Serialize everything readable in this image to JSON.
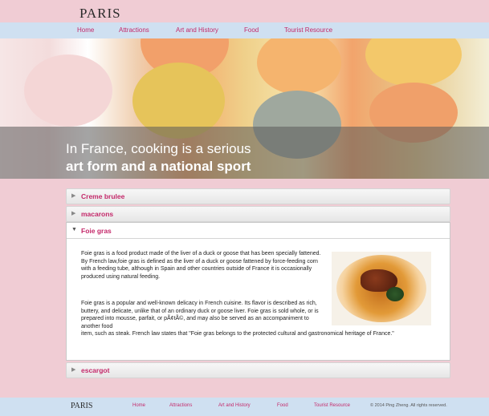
{
  "site": {
    "logo": "PARIS"
  },
  "nav": [
    "Home",
    "Attractions",
    "Art and History",
    "Food",
    "Tourist Resource"
  ],
  "hero": {
    "line1": "In France, cooking is a serious",
    "line2": "art form and a national sport"
  },
  "accordion": {
    "collapsed_top": [
      "Creme brulee",
      "macarons"
    ],
    "expanded": {
      "title": "Foie gras",
      "paragraph1": "Foie gras is a food product made of the liver of a duck or goose that has been specially fattened. By French law,foie gras is defined as the liver of a duck or goose fattened by force-feeding corn with a feeding tube, although in Spain and other countries outside of France it is occasionally produced using natural feeding.",
      "paragraph2": "Foie gras is a popular and well-known delicacy in French cuisine. Its flavor is described as rich, buttery, and delicate, unlike that of an ordinary duck or goose liver. Foie gras is sold whole, or is prepared into mousse, parfait, or pÃ¢tÃ©, and may also be served as an accompaniment to another food",
      "paragraph2_tail": "item, such as steak. French law states that \"Foie gras belongs to the protected cultural and gastronomical heritage of France.\""
    },
    "collapsed_bottom": [
      "escargot"
    ]
  },
  "footer": {
    "logo": "PARIS",
    "nav": [
      "Home",
      "Attractions",
      "Art and History",
      "Food",
      "Tourist Resource"
    ],
    "copyright": "© 2014 Ping Zheng. All rights reserved."
  },
  "colors": {
    "background_pink": "#f0ccd4",
    "nav_blue": "#cfe0f1",
    "accent_magenta": "#c4296a"
  }
}
